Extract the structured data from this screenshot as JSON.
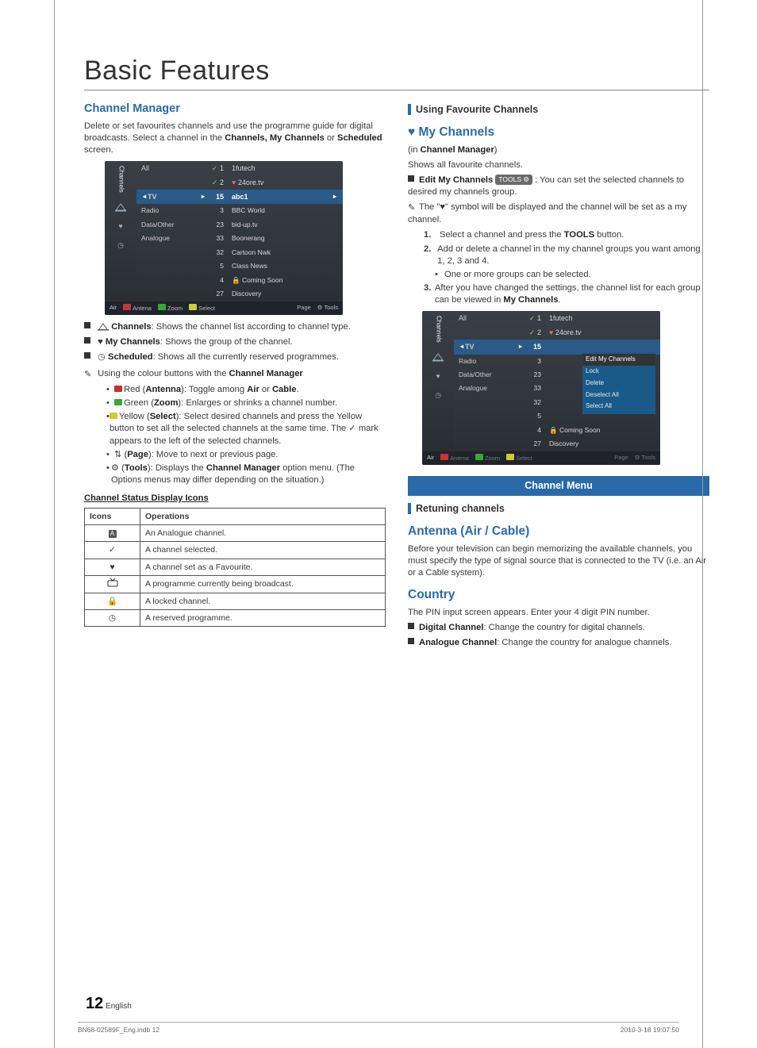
{
  "page_title": "Basic Features",
  "left": {
    "cm_heading": "Channel Manager",
    "cm_intro_a": "Delete or set favourites channels and use the programme guide for digital broadcasts. Select a channel in the ",
    "cm_intro_b": "Channels, My Channels",
    "cm_intro_c": " or ",
    "cm_intro_d": "Scheduled",
    "cm_intro_e": " screen.",
    "ui1": {
      "side_label": "Channels",
      "all": "All",
      "check1": "1",
      "check2": "2",
      "top_ch1": "1futech",
      "top_ch2": "24ore.tv",
      "sel_type": "TV",
      "sel_num": "15",
      "sel_name": "abc1",
      "types": [
        "Radio",
        "Data/Other",
        "Analogue"
      ],
      "nums": [
        "3",
        "23",
        "33",
        "32",
        "5",
        "4",
        "27"
      ],
      "names": [
        "BBC World",
        "bid-up.tv",
        "Boonerang",
        "Cartoon Nwk",
        "Class News",
        "Coming Soon",
        "Discovery"
      ],
      "air": "Air",
      "f_antena": "Antena",
      "f_zoom": "Zoom",
      "f_select": "Select",
      "f_page": "Page",
      "f_tools": "Tools"
    },
    "li_channels_b": "Channels",
    "li_channels_t": ": Shows the channel list according to channel type.",
    "li_mych_b": "My Channels",
    "li_mych_t": ": Shows the group of the channel.",
    "li_sched_b": "Scheduled",
    "li_sched_t": ": Shows all the currently reserved programmes.",
    "note_colour_a": "Using the colour buttons with the ",
    "note_colour_b": "Channel Manager",
    "cb_red_a": "Red (",
    "cb_red_b": "Antenna",
    "cb_red_c": "): Toggle among ",
    "cb_red_d": "Air",
    "cb_red_e": " or ",
    "cb_red_f": "Cable",
    "cb_red_g": ".",
    "cb_green_a": "Green (",
    "cb_green_b": "Zoom",
    "cb_green_c": "): Enlarges or shrinks a channel number.",
    "cb_yellow_a": "Yellow (",
    "cb_yellow_b": "Select",
    "cb_yellow_c": "): Select desired channels and press the Yellow button to set all the selected channels at the same time. The ✓ mark appears to the left of the selected channels.",
    "cb_page_b": "Page",
    "cb_page_t": "): Move to next or previous page.",
    "cb_tools_b": "Tools",
    "cb_tools_t1": "): Displays the ",
    "cb_tools_t2": "Channel Manager",
    "cb_tools_t3": " option menu. (The Options menus may differ depending on the situation.)",
    "status_heading": "Channel Status Display Icons",
    "table": {
      "h1": "Icons",
      "h2": "Operations",
      "r1": "An Analogue channel.",
      "r2": "A channel selected.",
      "r3": "A channel set as a Favourite.",
      "r4": "A programme currently being broadcast.",
      "r5": "A locked channel.",
      "r6": "A reserved programme."
    }
  },
  "right": {
    "ufc": "Using Favourite Channels",
    "mych_heading": "My Channels",
    "in_cm_a": "(in ",
    "in_cm_b": "Channel Manager",
    "in_cm_c": ")",
    "shows": "Shows all favourite channels.",
    "edit_b": "Edit My Channels",
    "tools_badge": "TOOLS",
    "edit_t": " : You can set the selected channels to desired my channels group.",
    "note_heart": "The \"♥\" symbol will be displayed and the channel will be set as a my channel.",
    "step1_a": "Select a channel and press the ",
    "step1_b": "TOOLS",
    "step1_c": " button.",
    "step2": "Add or delete a channel in the my channel groups you want among 1, 2, 3 and 4.",
    "step2_sub": "One or more groups can be selected.",
    "step3_a": "After you have changed the settings, the channel list for each group can be viewed in ",
    "step3_b": "My Channels",
    "step3_c": ".",
    "ui2": {
      "side_label": "Channels",
      "all": "All",
      "check1": "1",
      "check2": "2",
      "top_ch1": "1futech",
      "top_ch2": "24ore.tv",
      "sel_type": "TV",
      "sel_num": "15",
      "ctx_hdr": "Edit My Channels",
      "ctx_items": [
        "Lock",
        "Delete",
        "Deselect All",
        "Select All"
      ],
      "types": [
        "Radio",
        "Data/Other",
        "Analogue"
      ],
      "nums": [
        "3",
        "23",
        "33",
        "32",
        "5",
        "4",
        "27"
      ],
      "names_last2": [
        "Coming Soon",
        "Discovery"
      ],
      "air": "Air",
      "f_antena": "Antena",
      "f_zoom": "Zoom",
      "f_select": "Select",
      "f_page": "Page",
      "f_tools": "Tools"
    },
    "chmenu": "Channel Menu",
    "retune": "Retuning channels",
    "antenna_h": "Antenna (Air / Cable)",
    "antenna_t": "Before your television can begin memorizing the available channels, you must specify the type of signal source that is connected to the TV (i.e. an Air or a Cable system).",
    "country_h": "Country",
    "country_t": "The PIN input screen appears. Enter your 4 digit PIN number.",
    "dig_b": "Digital Channel",
    "dig_t": ": Change the country for digital channels.",
    "ana_b": "Analogue Channel",
    "ana_t": ": Change the country for analogue channels."
  },
  "footer": {
    "pageno": "12",
    "lang": "English",
    "docref": "BN68-02589F_Eng.indb   12",
    "timestamp": "2010-3-18   19:07:50"
  }
}
